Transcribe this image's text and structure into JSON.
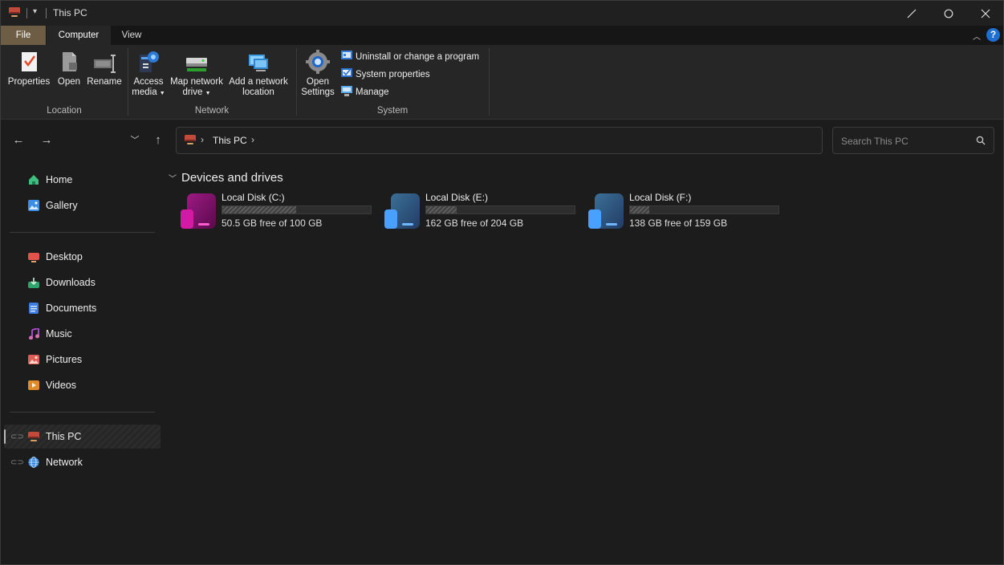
{
  "window": {
    "title": "This PC"
  },
  "ribbon_tabs": [
    {
      "label": "File"
    },
    {
      "label": "Computer"
    },
    {
      "label": "View"
    }
  ],
  "ribbon": {
    "location": {
      "label": "Location",
      "buttons": [
        {
          "label": "Properties",
          "icon": "properties-icon"
        },
        {
          "label": "Open",
          "icon": "open-icon"
        },
        {
          "label": "Rename",
          "icon": "rename-icon"
        }
      ]
    },
    "network": {
      "label": "Network",
      "access_media": {
        "line1": "Access",
        "line2": "media"
      },
      "map_drive": {
        "line1": "Map network",
        "line2": "drive"
      },
      "add_location": {
        "line1": "Add a network",
        "line2": "location"
      }
    },
    "system": {
      "label": "System",
      "open_settings": {
        "line1": "Open",
        "line2": "Settings"
      },
      "uninstall": "Uninstall or change a program",
      "system_properties": "System properties",
      "manage": "Manage"
    }
  },
  "address": {
    "segment": "This PC"
  },
  "search": {
    "placeholder": "Search This PC"
  },
  "sidebar": {
    "pinned": [
      {
        "label": "Home",
        "icon": "home-icon",
        "color": "#3fbf7f"
      },
      {
        "label": "Gallery",
        "icon": "gallery-icon",
        "color": "#3a8ee6"
      }
    ],
    "quick": [
      {
        "label": "Desktop",
        "icon": "desktop-icon",
        "color": "#e0524a"
      },
      {
        "label": "Downloads",
        "icon": "downloads-icon",
        "color": "#2fa36b"
      },
      {
        "label": "Documents",
        "icon": "documents-icon",
        "color": "#3b7de0"
      },
      {
        "label": "Music",
        "icon": "music-icon",
        "color": "#b04fd6"
      },
      {
        "label": "Pictures",
        "icon": "pictures-icon",
        "color": "#e05a5a"
      },
      {
        "label": "Videos",
        "icon": "videos-icon",
        "color": "#e08a2a"
      }
    ],
    "locations": [
      {
        "label": "This PC",
        "icon": "this-pc-icon"
      },
      {
        "label": "Network",
        "icon": "network-icon"
      }
    ]
  },
  "content": {
    "section": "Devices and drives",
    "drives": [
      {
        "name": "Local Disk (C:)",
        "free": "50.5 GB free of 100 GB",
        "used_fraction": 0.495,
        "color": "#c0189a"
      },
      {
        "name": "Local Disk (E:)",
        "free": "162 GB free of 204 GB",
        "used_fraction": 0.206,
        "color": "#3f8ae0"
      },
      {
        "name": "Local Disk (F:)",
        "free": "138 GB free of 159 GB",
        "used_fraction": 0.132,
        "color": "#3f8ae0"
      }
    ]
  }
}
